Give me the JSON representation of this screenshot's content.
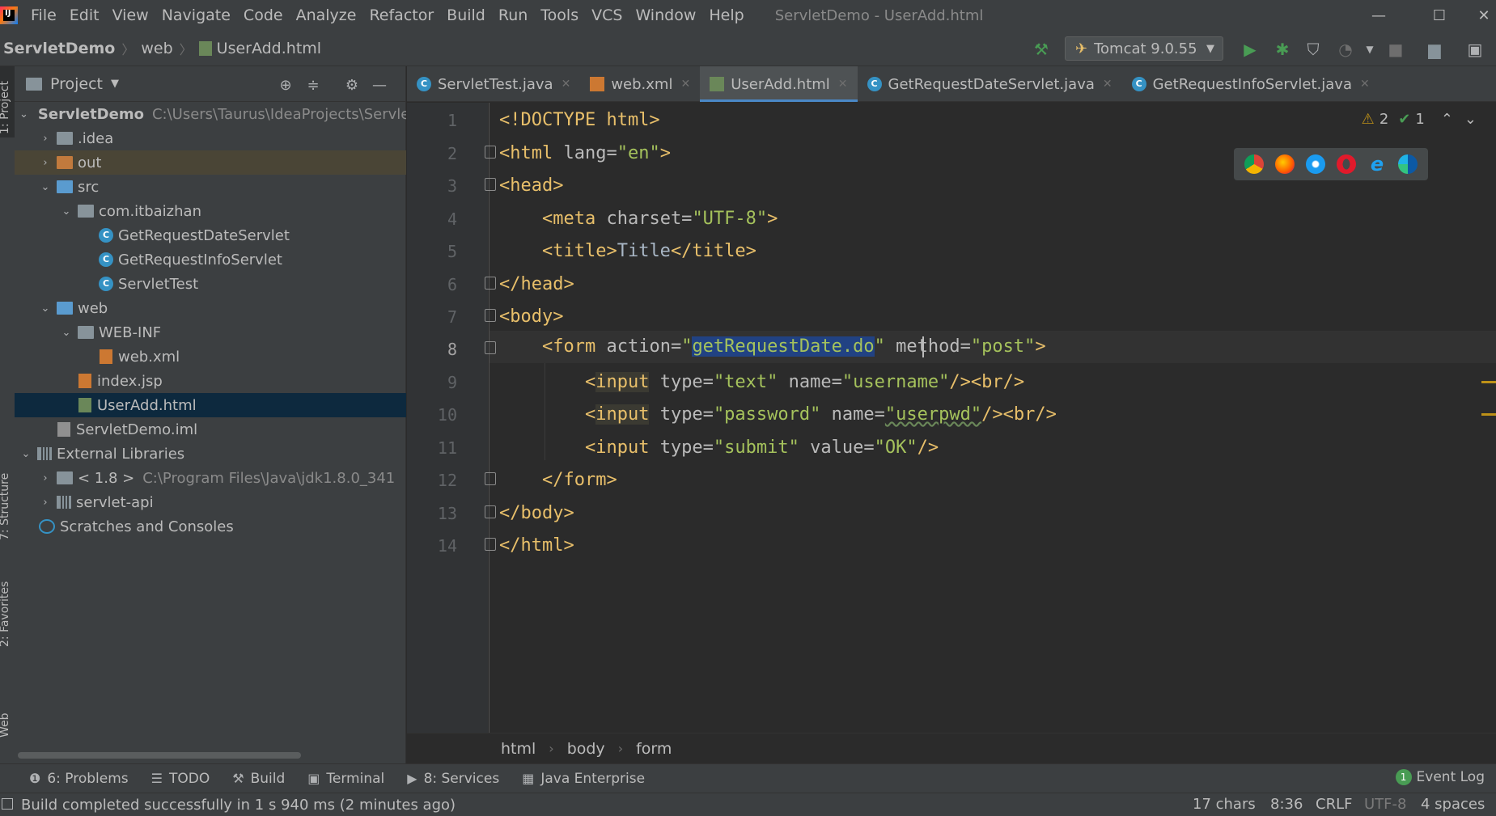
{
  "menubar": {
    "logo_text": "IJ",
    "items": [
      "File",
      "Edit",
      "View",
      "Navigate",
      "Code",
      "Analyze",
      "Refactor",
      "Build",
      "Run",
      "Tools",
      "VCS",
      "Window",
      "Help"
    ],
    "window_title": "ServletDemo - UserAdd.html",
    "minimize": "—",
    "maximize": "☐",
    "close": "✕"
  },
  "navbar": {
    "crumbs": [
      "ServletDemo",
      "web",
      "UserAdd.html"
    ],
    "run_config": "Tomcat 9.0.55"
  },
  "left_strip": {
    "project": "1: Project",
    "structure": "7: Structure",
    "favorites": "2: Favorites",
    "web": "Web"
  },
  "project_panel": {
    "title": "Project",
    "tree": [
      {
        "label": "ServletDemo",
        "path": "C:\\Users\\Taurus\\IdeaProjects\\ServletDemo"
      },
      {
        "label": ".idea"
      },
      {
        "label": "out"
      },
      {
        "label": "src"
      },
      {
        "label": "com.itbaizhan"
      },
      {
        "label": "GetRequestDateServlet"
      },
      {
        "label": "GetRequestInfoServlet"
      },
      {
        "label": "ServletTest"
      },
      {
        "label": "web"
      },
      {
        "label": "WEB-INF"
      },
      {
        "label": "web.xml"
      },
      {
        "label": "index.jsp"
      },
      {
        "label": "UserAdd.html"
      },
      {
        "label": "ServletDemo.iml"
      },
      {
        "label": "External Libraries"
      },
      {
        "label": "< 1.8 >",
        "path": "C:\\Program Files\\Java\\jdk1.8.0_341"
      },
      {
        "label": "servlet-api"
      },
      {
        "label": "Scratches and Consoles"
      }
    ]
  },
  "editor_tabs": [
    {
      "label": "ServletTest.java"
    },
    {
      "label": "web.xml"
    },
    {
      "label": "UserAdd.html"
    },
    {
      "label": "GetRequestDateServlet.java"
    },
    {
      "label": "GetRequestInfoServlet.java"
    }
  ],
  "editor": {
    "line_numbers": [
      "1",
      "2",
      "3",
      "4",
      "5",
      "6",
      "7",
      "8",
      "9",
      "10",
      "11",
      "12",
      "13",
      "14"
    ],
    "current_line": 8,
    "inspection": {
      "warnings": "2",
      "ok": "1"
    },
    "code": {
      "l1": "<!DOCTYPE html>",
      "l2_open": "<html ",
      "l2_attr": "lang=",
      "l2_val": "\"en\"",
      "l2_close": ">",
      "l3": "<head>",
      "l4_open": "<meta ",
      "l4_attr": "charset=",
      "l4_val": "\"UTF-8\"",
      "l4_close": ">",
      "l5_open": "<title>",
      "l5_text": "Title",
      "l5_close": "</title>",
      "l6": "</head>",
      "l7": "<body>",
      "l8_open": "<form ",
      "l8_attr1": "action=",
      "l8_q1": "\"",
      "l8_sel": "getRequestDate.do",
      "l8_q2": "\"",
      "l8_attr2": " method=",
      "l8_val2": "\"post\"",
      "l8_close": ">",
      "l9_lt": "<",
      "l9_tag": "input",
      "l9_attr1": " type=",
      "l9_val1": "\"text\"",
      "l9_attr2": " name=",
      "l9_val2": "\"username\"",
      "l9_close": "/><br/>",
      "l10_lt": "<",
      "l10_tag": "input",
      "l10_attr1": " type=",
      "l10_val1": "\"password\"",
      "l10_attr2": " name=",
      "l10_val2": "\"userpwd\"",
      "l10_close": "/><br/>",
      "l11_open": "<input ",
      "l11_attr1": "type=",
      "l11_val1": "\"submit\"",
      "l11_attr2": " value=",
      "l11_val2": "\"OK\"",
      "l11_close": "/>",
      "l12": "</form>",
      "l13": "</body>",
      "l14": "</html>"
    },
    "breadcrumb": [
      "html",
      "body",
      "form"
    ]
  },
  "tool_bar": {
    "problems": "6: Problems",
    "todo": "TODO",
    "build": "Build",
    "terminal": "Terminal",
    "services": "8: Services",
    "java_enterprise": "Java Enterprise",
    "event_log": "Event Log",
    "event_count": "1"
  },
  "status_bar": {
    "message": "Build completed successfully in 1 s 940 ms (2 minutes ago)",
    "chars": "17 chars",
    "position": "8:36",
    "line_sep": "CRLF",
    "encoding": "UTF-8",
    "indent": "4 spaces"
  },
  "colors": {
    "background": "#2b2b2b",
    "panel": "#3c3f41",
    "tag": "#e8bf6a",
    "string": "#a5c25c",
    "selection": "#214283",
    "run_green": "#499c54"
  }
}
